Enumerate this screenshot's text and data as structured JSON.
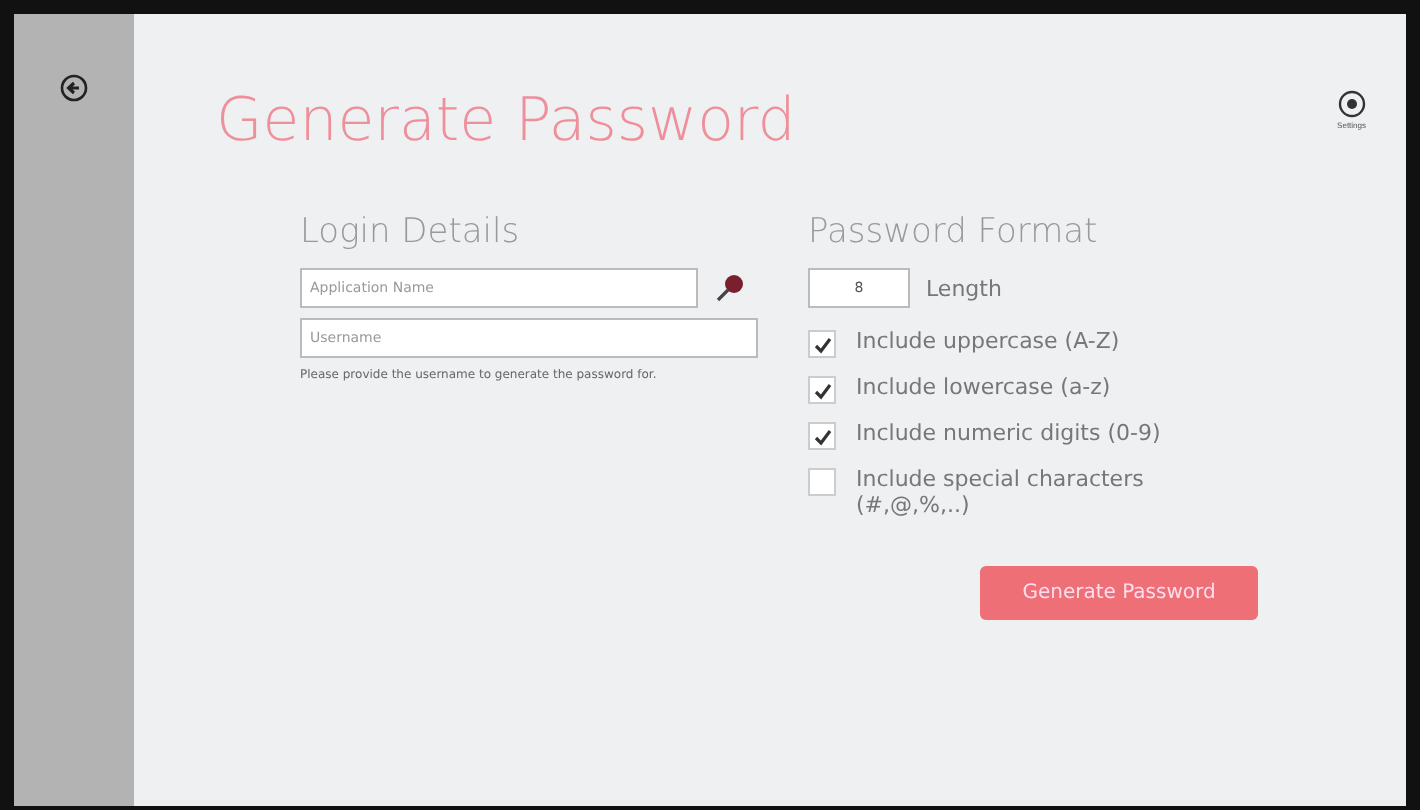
{
  "title": "Generate Password",
  "settings": {
    "label": "Settings"
  },
  "login": {
    "heading": "Login Details",
    "application": {
      "placeholder": "Application Name"
    },
    "username": {
      "placeholder": "Username"
    },
    "hint": "Please provide the username to generate the password for."
  },
  "format": {
    "heading": "Password Format",
    "length": {
      "value": "8",
      "label": "Length"
    },
    "options": [
      {
        "label": "Include uppercase (A-Z)",
        "checked": true
      },
      {
        "label": "Include lowercase (a-z)",
        "checked": true
      },
      {
        "label": "Include numeric digits (0-9)",
        "checked": true
      },
      {
        "label": "Include special characters (#,@,%,..)",
        "checked": false
      }
    ]
  },
  "button": "Generate Password"
}
